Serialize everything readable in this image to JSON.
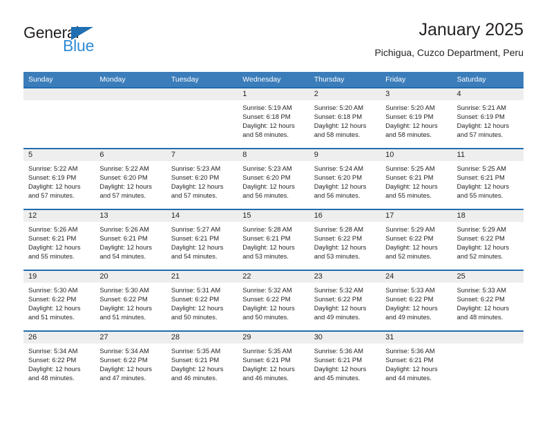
{
  "brand": {
    "word1": "General",
    "word2": "Blue",
    "triangle_color": "#1f6fb2",
    "word2_color": "#2e8ad4"
  },
  "header": {
    "title": "January 2025",
    "subtitle": "Pichigua, Cuzco Department, Peru"
  },
  "colors": {
    "header_blue": "#3b7dba",
    "row_rule_blue": "#1f6cb0",
    "day_band_gray": "#eeeeee",
    "text": "#231f20"
  },
  "weekdays": [
    "Sunday",
    "Monday",
    "Tuesday",
    "Wednesday",
    "Thursday",
    "Friday",
    "Saturday"
  ],
  "weeks": [
    [
      {
        "day": "",
        "sunrise": "",
        "sunset": "",
        "daylight1": "",
        "daylight2": ""
      },
      {
        "day": "",
        "sunrise": "",
        "sunset": "",
        "daylight1": "",
        "daylight2": ""
      },
      {
        "day": "",
        "sunrise": "",
        "sunset": "",
        "daylight1": "",
        "daylight2": ""
      },
      {
        "day": "1",
        "sunrise": "Sunrise: 5:19 AM",
        "sunset": "Sunset: 6:18 PM",
        "daylight1": "Daylight: 12 hours",
        "daylight2": "and 58 minutes."
      },
      {
        "day": "2",
        "sunrise": "Sunrise: 5:20 AM",
        "sunset": "Sunset: 6:18 PM",
        "daylight1": "Daylight: 12 hours",
        "daylight2": "and 58 minutes."
      },
      {
        "day": "3",
        "sunrise": "Sunrise: 5:20 AM",
        "sunset": "Sunset: 6:19 PM",
        "daylight1": "Daylight: 12 hours",
        "daylight2": "and 58 minutes."
      },
      {
        "day": "4",
        "sunrise": "Sunrise: 5:21 AM",
        "sunset": "Sunset: 6:19 PM",
        "daylight1": "Daylight: 12 hours",
        "daylight2": "and 57 minutes."
      }
    ],
    [
      {
        "day": "5",
        "sunrise": "Sunrise: 5:22 AM",
        "sunset": "Sunset: 6:19 PM",
        "daylight1": "Daylight: 12 hours",
        "daylight2": "and 57 minutes."
      },
      {
        "day": "6",
        "sunrise": "Sunrise: 5:22 AM",
        "sunset": "Sunset: 6:20 PM",
        "daylight1": "Daylight: 12 hours",
        "daylight2": "and 57 minutes."
      },
      {
        "day": "7",
        "sunrise": "Sunrise: 5:23 AM",
        "sunset": "Sunset: 6:20 PM",
        "daylight1": "Daylight: 12 hours",
        "daylight2": "and 57 minutes."
      },
      {
        "day": "8",
        "sunrise": "Sunrise: 5:23 AM",
        "sunset": "Sunset: 6:20 PM",
        "daylight1": "Daylight: 12 hours",
        "daylight2": "and 56 minutes."
      },
      {
        "day": "9",
        "sunrise": "Sunrise: 5:24 AM",
        "sunset": "Sunset: 6:20 PM",
        "daylight1": "Daylight: 12 hours",
        "daylight2": "and 56 minutes."
      },
      {
        "day": "10",
        "sunrise": "Sunrise: 5:25 AM",
        "sunset": "Sunset: 6:21 PM",
        "daylight1": "Daylight: 12 hours",
        "daylight2": "and 55 minutes."
      },
      {
        "day": "11",
        "sunrise": "Sunrise: 5:25 AM",
        "sunset": "Sunset: 6:21 PM",
        "daylight1": "Daylight: 12 hours",
        "daylight2": "and 55 minutes."
      }
    ],
    [
      {
        "day": "12",
        "sunrise": "Sunrise: 5:26 AM",
        "sunset": "Sunset: 6:21 PM",
        "daylight1": "Daylight: 12 hours",
        "daylight2": "and 55 minutes."
      },
      {
        "day": "13",
        "sunrise": "Sunrise: 5:26 AM",
        "sunset": "Sunset: 6:21 PM",
        "daylight1": "Daylight: 12 hours",
        "daylight2": "and 54 minutes."
      },
      {
        "day": "14",
        "sunrise": "Sunrise: 5:27 AM",
        "sunset": "Sunset: 6:21 PM",
        "daylight1": "Daylight: 12 hours",
        "daylight2": "and 54 minutes."
      },
      {
        "day": "15",
        "sunrise": "Sunrise: 5:28 AM",
        "sunset": "Sunset: 6:21 PM",
        "daylight1": "Daylight: 12 hours",
        "daylight2": "and 53 minutes."
      },
      {
        "day": "16",
        "sunrise": "Sunrise: 5:28 AM",
        "sunset": "Sunset: 6:22 PM",
        "daylight1": "Daylight: 12 hours",
        "daylight2": "and 53 minutes."
      },
      {
        "day": "17",
        "sunrise": "Sunrise: 5:29 AM",
        "sunset": "Sunset: 6:22 PM",
        "daylight1": "Daylight: 12 hours",
        "daylight2": "and 52 minutes."
      },
      {
        "day": "18",
        "sunrise": "Sunrise: 5:29 AM",
        "sunset": "Sunset: 6:22 PM",
        "daylight1": "Daylight: 12 hours",
        "daylight2": "and 52 minutes."
      }
    ],
    [
      {
        "day": "19",
        "sunrise": "Sunrise: 5:30 AM",
        "sunset": "Sunset: 6:22 PM",
        "daylight1": "Daylight: 12 hours",
        "daylight2": "and 51 minutes."
      },
      {
        "day": "20",
        "sunrise": "Sunrise: 5:30 AM",
        "sunset": "Sunset: 6:22 PM",
        "daylight1": "Daylight: 12 hours",
        "daylight2": "and 51 minutes."
      },
      {
        "day": "21",
        "sunrise": "Sunrise: 5:31 AM",
        "sunset": "Sunset: 6:22 PM",
        "daylight1": "Daylight: 12 hours",
        "daylight2": "and 50 minutes."
      },
      {
        "day": "22",
        "sunrise": "Sunrise: 5:32 AM",
        "sunset": "Sunset: 6:22 PM",
        "daylight1": "Daylight: 12 hours",
        "daylight2": "and 50 minutes."
      },
      {
        "day": "23",
        "sunrise": "Sunrise: 5:32 AM",
        "sunset": "Sunset: 6:22 PM",
        "daylight1": "Daylight: 12 hours",
        "daylight2": "and 49 minutes."
      },
      {
        "day": "24",
        "sunrise": "Sunrise: 5:33 AM",
        "sunset": "Sunset: 6:22 PM",
        "daylight1": "Daylight: 12 hours",
        "daylight2": "and 49 minutes."
      },
      {
        "day": "25",
        "sunrise": "Sunrise: 5:33 AM",
        "sunset": "Sunset: 6:22 PM",
        "daylight1": "Daylight: 12 hours",
        "daylight2": "and 48 minutes."
      }
    ],
    [
      {
        "day": "26",
        "sunrise": "Sunrise: 5:34 AM",
        "sunset": "Sunset: 6:22 PM",
        "daylight1": "Daylight: 12 hours",
        "daylight2": "and 48 minutes."
      },
      {
        "day": "27",
        "sunrise": "Sunrise: 5:34 AM",
        "sunset": "Sunset: 6:22 PM",
        "daylight1": "Daylight: 12 hours",
        "daylight2": "and 47 minutes."
      },
      {
        "day": "28",
        "sunrise": "Sunrise: 5:35 AM",
        "sunset": "Sunset: 6:21 PM",
        "daylight1": "Daylight: 12 hours",
        "daylight2": "and 46 minutes."
      },
      {
        "day": "29",
        "sunrise": "Sunrise: 5:35 AM",
        "sunset": "Sunset: 6:21 PM",
        "daylight1": "Daylight: 12 hours",
        "daylight2": "and 46 minutes."
      },
      {
        "day": "30",
        "sunrise": "Sunrise: 5:36 AM",
        "sunset": "Sunset: 6:21 PM",
        "daylight1": "Daylight: 12 hours",
        "daylight2": "and 45 minutes."
      },
      {
        "day": "31",
        "sunrise": "Sunrise: 5:36 AM",
        "sunset": "Sunset: 6:21 PM",
        "daylight1": "Daylight: 12 hours",
        "daylight2": "and 44 minutes."
      },
      {
        "day": "",
        "sunrise": "",
        "sunset": "",
        "daylight1": "",
        "daylight2": ""
      }
    ]
  ]
}
